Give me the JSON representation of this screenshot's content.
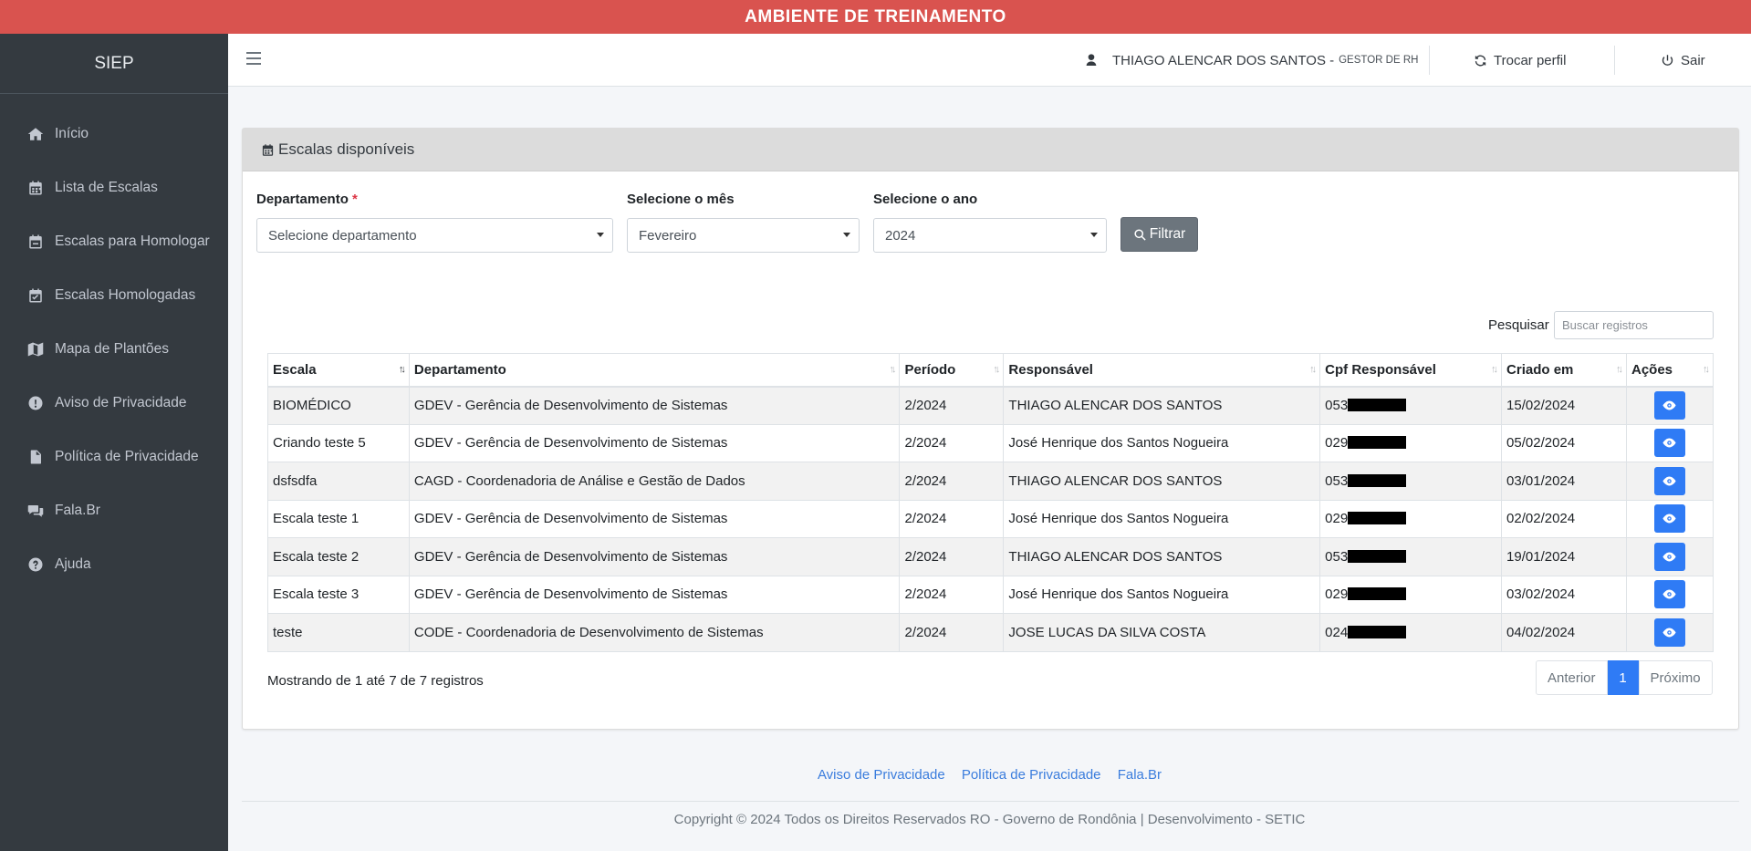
{
  "banner": {
    "text": "AMBIENTE DE TREINAMENTO"
  },
  "colors": {
    "banner": "#d9534f",
    "sidebar": "#343a40",
    "primary": "#2f7bf5",
    "filter_button": "#6c757d"
  },
  "sidebar": {
    "brand": "SIEP",
    "items": [
      {
        "label": "Início",
        "icon": "home-icon"
      },
      {
        "label": "Lista de Escalas",
        "icon": "calendar-icon"
      },
      {
        "label": "Escalas para Homologar",
        "icon": "calendar-minus-icon"
      },
      {
        "label": "Escalas Homologadas",
        "icon": "calendar-check-icon"
      },
      {
        "label": "Mapa de Plantões",
        "icon": "map-icon"
      },
      {
        "label": "Aviso de Privacidade",
        "icon": "exclamation-circle-icon"
      },
      {
        "label": "Política de Privacidade",
        "icon": "file-icon"
      },
      {
        "label": "Fala.Br",
        "icon": "comments-icon"
      },
      {
        "label": "Ajuda",
        "icon": "question-circle-icon"
      }
    ]
  },
  "topbar": {
    "user_name": "THIAGO ALENCAR DOS SANTOS - ",
    "user_role": "GESTOR DE RH",
    "switch_profile": "Trocar perfil",
    "logout": "Sair"
  },
  "card": {
    "title": "Escalas disponíveis"
  },
  "filters": {
    "department": {
      "label": "Departamento",
      "required_mark": "*",
      "value": "Selecione departamento"
    },
    "month": {
      "label": "Selecione o mês",
      "value": "Fevereiro"
    },
    "year": {
      "label": "Selecione o ano",
      "value": "2024"
    },
    "filter_button": "Filtrar"
  },
  "search": {
    "label": "Pesquisar",
    "placeholder": "Buscar registros"
  },
  "table": {
    "columns": [
      "Escala",
      "Departamento",
      "Período",
      "Responsável",
      "Cpf Responsável",
      "Criado em",
      "Ações"
    ],
    "rows": [
      {
        "escala": "BIOMÉDICO",
        "departamento": "GDEV - Gerência de Desenvolvimento de Sistemas",
        "periodo": "2/2024",
        "responsavel": "THIAGO ALENCAR DOS SANTOS",
        "cpf_prefix": "053",
        "criado_em": "15/02/2024"
      },
      {
        "escala": "Criando teste 5",
        "departamento": "GDEV - Gerência de Desenvolvimento de Sistemas",
        "periodo": "2/2024",
        "responsavel": "José Henrique dos Santos Nogueira",
        "cpf_prefix": "029",
        "criado_em": "05/02/2024"
      },
      {
        "escala": "dsfsdfa",
        "departamento": "CAGD - Coordenadoria de Análise e Gestão de Dados",
        "periodo": "2/2024",
        "responsavel": "THIAGO ALENCAR DOS SANTOS",
        "cpf_prefix": "053",
        "criado_em": "03/01/2024"
      },
      {
        "escala": "Escala teste 1",
        "departamento": "GDEV - Gerência de Desenvolvimento de Sistemas",
        "periodo": "2/2024",
        "responsavel": "José Henrique dos Santos Nogueira",
        "cpf_prefix": "029",
        "criado_em": "02/02/2024"
      },
      {
        "escala": "Escala teste 2",
        "departamento": "GDEV - Gerência de Desenvolvimento de Sistemas",
        "periodo": "2/2024",
        "responsavel": "THIAGO ALENCAR DOS SANTOS",
        "cpf_prefix": "053",
        "criado_em": "19/01/2024"
      },
      {
        "escala": "Escala teste 3",
        "departamento": "GDEV - Gerência de Desenvolvimento de Sistemas",
        "periodo": "2/2024",
        "responsavel": "José Henrique dos Santos Nogueira",
        "cpf_prefix": "029",
        "criado_em": "03/02/2024"
      },
      {
        "escala": "teste",
        "departamento": "CODE - Coordenadoria de Desenvolvimento de Sistemas",
        "periodo": "2/2024",
        "responsavel": "JOSE LUCAS DA SILVA COSTA",
        "cpf_prefix": "024",
        "criado_em": "04/02/2024"
      }
    ],
    "action_icon": "eye-icon"
  },
  "table_info": "Mostrando de 1 até 7 de 7 registros",
  "pagination": {
    "prev": "Anterior",
    "current": "1",
    "next": "Próximo"
  },
  "footer": {
    "links": [
      "Aviso de Privacidade",
      "Política de Privacidade",
      "Fala.Br"
    ],
    "copyright": "Copyright © 2024 Todos os Direitos Reservados RO - Governo de Rondônia | Desenvolvimento - SETIC"
  }
}
